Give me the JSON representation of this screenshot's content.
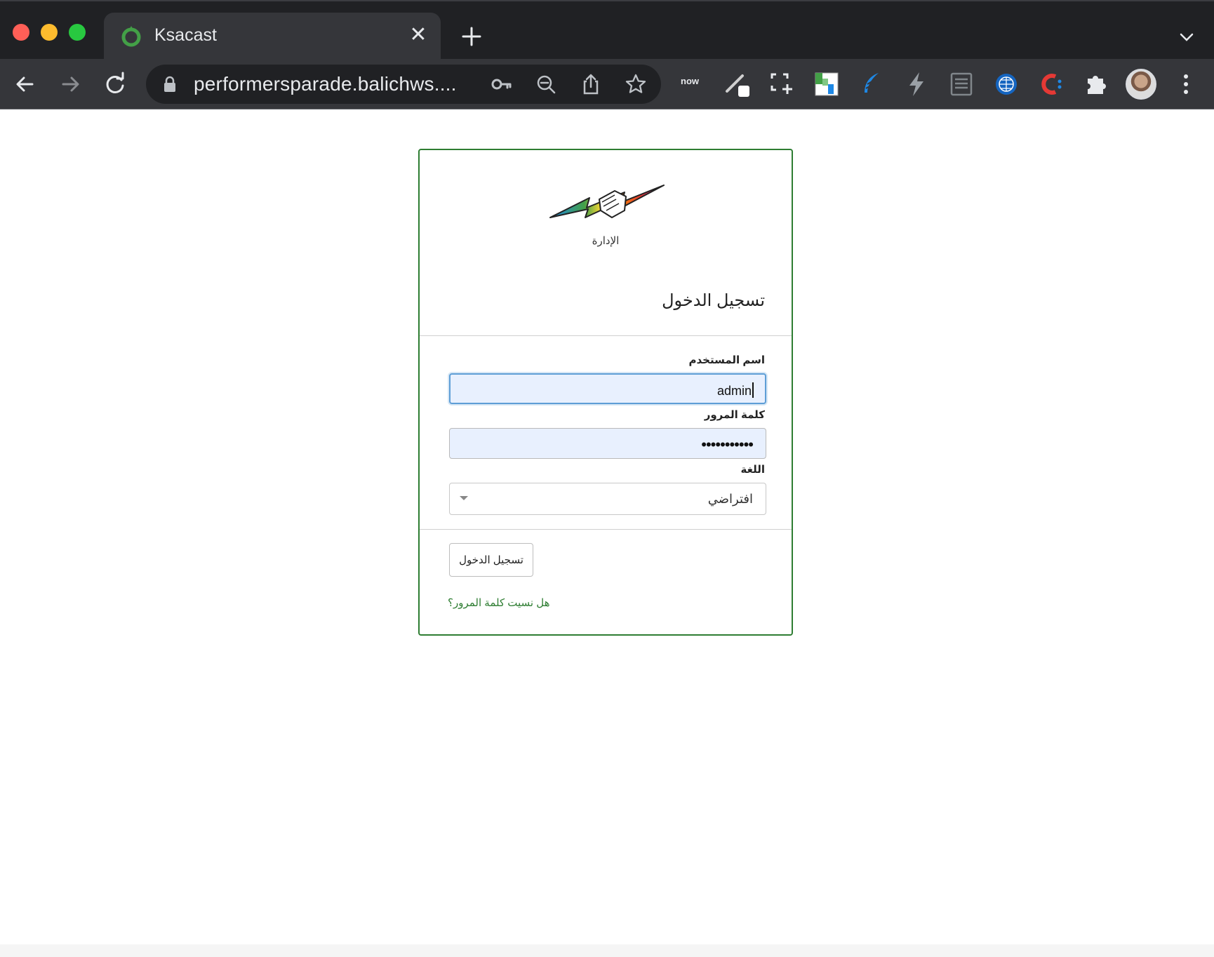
{
  "browser": {
    "tab_title": "Ksacast",
    "tab_close": "✕",
    "url": "performersparade.balichws....",
    "extensions": [
      "now-extension-icon",
      "pen-extension-icon",
      "screenshot-extension-icon",
      "sheet-extension-icon",
      "feather-extension-icon",
      "bolt-extension-icon",
      "reader-extension-icon",
      "globe-extension-icon",
      "c-extension-icon",
      "puzzle-icon"
    ],
    "now_badge": "now"
  },
  "login": {
    "logo_caption": "الإدارة",
    "heading": "تسجيل الدخول",
    "username_label": "اسم المستخدم",
    "username_value": "admin",
    "password_label": "كلمة المرور",
    "password_value": "•••••••••••",
    "language_label": "اللغة",
    "language_value": "افتراضي",
    "submit_label": "تسجيل الدخول",
    "forgot_label": "هل نسيت كلمة المرور؟"
  },
  "colors": {
    "accent": "#2e7d32",
    "chrome_dark": "#202124",
    "chrome_toolbar": "#35363a",
    "autofill": "#e8f0fe"
  }
}
